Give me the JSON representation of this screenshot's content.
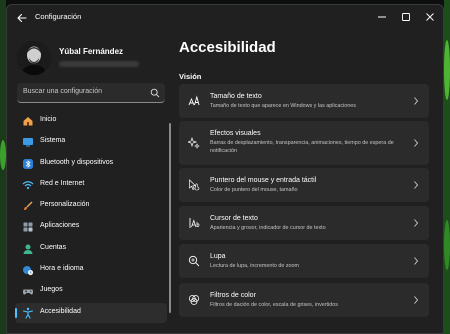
{
  "window": {
    "title": "Configuración"
  },
  "profile": {
    "name": "Yúbal Fernández"
  },
  "search": {
    "placeholder": "Buscar una configuración"
  },
  "sidebar": {
    "items": [
      {
        "label": "Inicio",
        "icon": "home-icon"
      },
      {
        "label": "Sistema",
        "icon": "system-icon"
      },
      {
        "label": "Bluetooth y dispositivos",
        "icon": "bluetooth-icon"
      },
      {
        "label": "Red e Internet",
        "icon": "wifi-icon"
      },
      {
        "label": "Personalización",
        "icon": "brush-icon"
      },
      {
        "label": "Aplicaciones",
        "icon": "apps-icon"
      },
      {
        "label": "Cuentas",
        "icon": "account-icon"
      },
      {
        "label": "Hora e idioma",
        "icon": "globe-clock-icon"
      },
      {
        "label": "Juegos",
        "icon": "gamepad-icon"
      },
      {
        "label": "Accesibilidad",
        "icon": "accessibility-icon",
        "selected": true
      }
    ]
  },
  "main": {
    "title": "Accesibilidad",
    "section": "Visión",
    "cards": [
      {
        "title": "Tamaño de texto",
        "description": "Tamaño de texto que aparece en Windows y las aplicaciones",
        "icon": "text-size-icon"
      },
      {
        "title": "Efectos visuales",
        "description": "Barras de desplazamiento, transparencia, animaciones, tiempo de espera de notificación",
        "icon": "sparkle-icon"
      },
      {
        "title": "Puntero del mouse y entrada táctil",
        "description": "Color de puntero del mouse, tamaño",
        "icon": "pointer-icon"
      },
      {
        "title": "Cursor de texto",
        "description": "Apariencia y grosor, indicador de cursor de texto",
        "icon": "text-cursor-icon"
      },
      {
        "title": "Lupa",
        "description": "Lectura de lupa, incremento de zoom",
        "icon": "magnifier-icon"
      },
      {
        "title": "Filtros de color",
        "description": "Filtros de dación de color, escala de grises, invertidos",
        "icon": "color-filter-icon"
      }
    ]
  },
  "colors": {
    "accent": "#4cc2ff",
    "window_bg": "#202020",
    "card_bg": "#2b2b2b",
    "wallpaper_green": "#3aa12a"
  }
}
